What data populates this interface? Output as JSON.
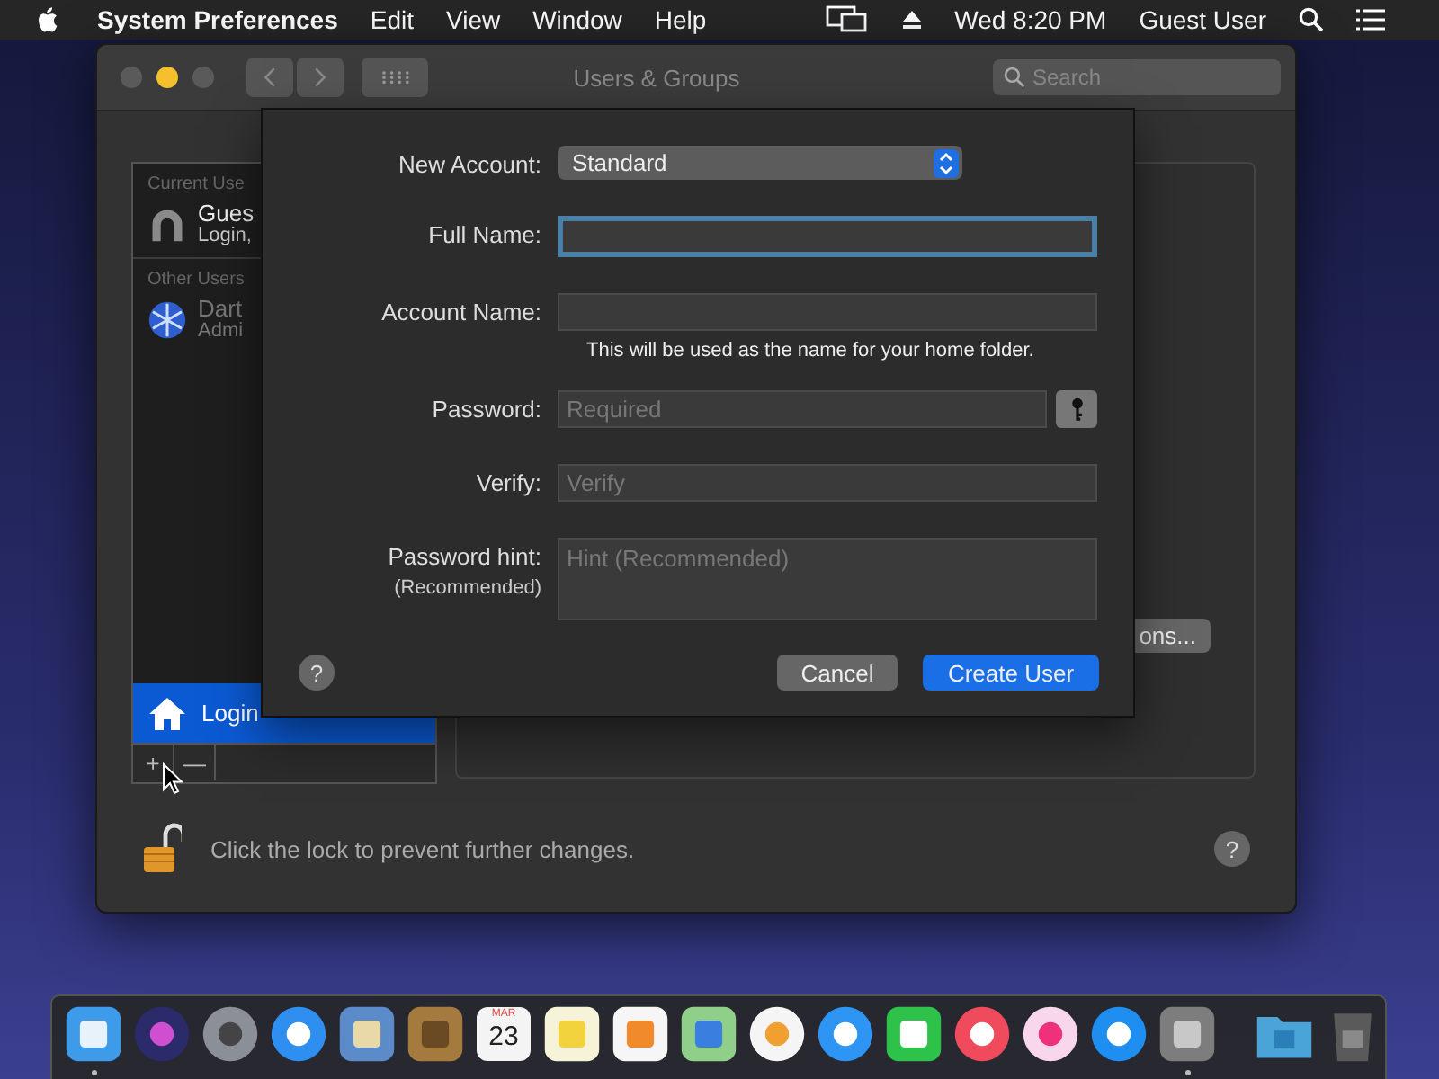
{
  "menu_bar": {
    "app_name": "System Preferences",
    "menus": [
      "Edit",
      "View",
      "Window",
      "Help"
    ],
    "clock": "Wed 8:20 PM",
    "user": "Guest User"
  },
  "window": {
    "title": "Users & Groups",
    "search": {
      "placeholder": "Search"
    }
  },
  "sidebar": {
    "sections": [
      {
        "heading": "Current Use",
        "users": [
          {
            "name": "Gues",
            "detail": "Login,",
            "kind": "silhouette",
            "selected": false
          }
        ]
      },
      {
        "heading": "Other Users",
        "users": [
          {
            "name": "Dart",
            "detail": "Admi",
            "kind": "snowflake",
            "selected": false
          }
        ]
      }
    ],
    "login_options": {
      "label": "Login",
      "selected": true
    },
    "list_buttons": [
      "+",
      "—"
    ]
  },
  "right_panel": {
    "button_fragment": "ons..."
  },
  "sheet": {
    "fields": [
      {
        "kind": "popup",
        "label": "New Account:",
        "value": "Standard"
      },
      {
        "kind": "text",
        "label": "Full Name:",
        "focused": true
      },
      {
        "kind": "text",
        "label": "Account Name:",
        "focused": false,
        "note": "This will be used as the name for your home folder."
      },
      {
        "kind": "password",
        "label": "Password:",
        "focused": false,
        "placeholder": "Required"
      },
      {
        "kind": "text",
        "label": "Verify:",
        "focused": false,
        "placeholder": "Verify"
      },
      {
        "kind": "area",
        "label": "Password hint:",
        "sublabel": "(Recommended)",
        "focused": false,
        "placeholder": "Hint (Recommended)"
      }
    ],
    "help_label": "?",
    "buttons": [
      {
        "label": "Cancel",
        "default": false
      },
      {
        "label": "Create User",
        "default": true
      }
    ]
  },
  "footer": {
    "lock_text": "Click the lock to prevent further changes.",
    "locked": false,
    "help_label": "?"
  },
  "dock": [
    {
      "kind": "finder",
      "running": true
    },
    {
      "kind": "siri",
      "running": false
    },
    {
      "kind": "launchpad",
      "running": false
    },
    {
      "kind": "safari",
      "running": false
    },
    {
      "kind": "mail",
      "running": false
    },
    {
      "kind": "contacts",
      "running": false
    },
    {
      "kind": "calendar",
      "running": false,
      "month": "MAR",
      "day": "23"
    },
    {
      "kind": "notes",
      "running": false
    },
    {
      "kind": "reminders",
      "running": false
    },
    {
      "kind": "maps",
      "running": false
    },
    {
      "kind": "photos",
      "running": false
    },
    {
      "kind": "messages",
      "running": false
    },
    {
      "kind": "facetime",
      "running": false
    },
    {
      "kind": "news",
      "running": false
    },
    {
      "kind": "music",
      "running": false
    },
    {
      "kind": "appstore",
      "running": false
    },
    {
      "kind": "preferences",
      "running": true
    },
    {
      "kind": "separator"
    },
    {
      "kind": "downloads",
      "running": false
    },
    {
      "kind": "trash",
      "running": false
    }
  ]
}
